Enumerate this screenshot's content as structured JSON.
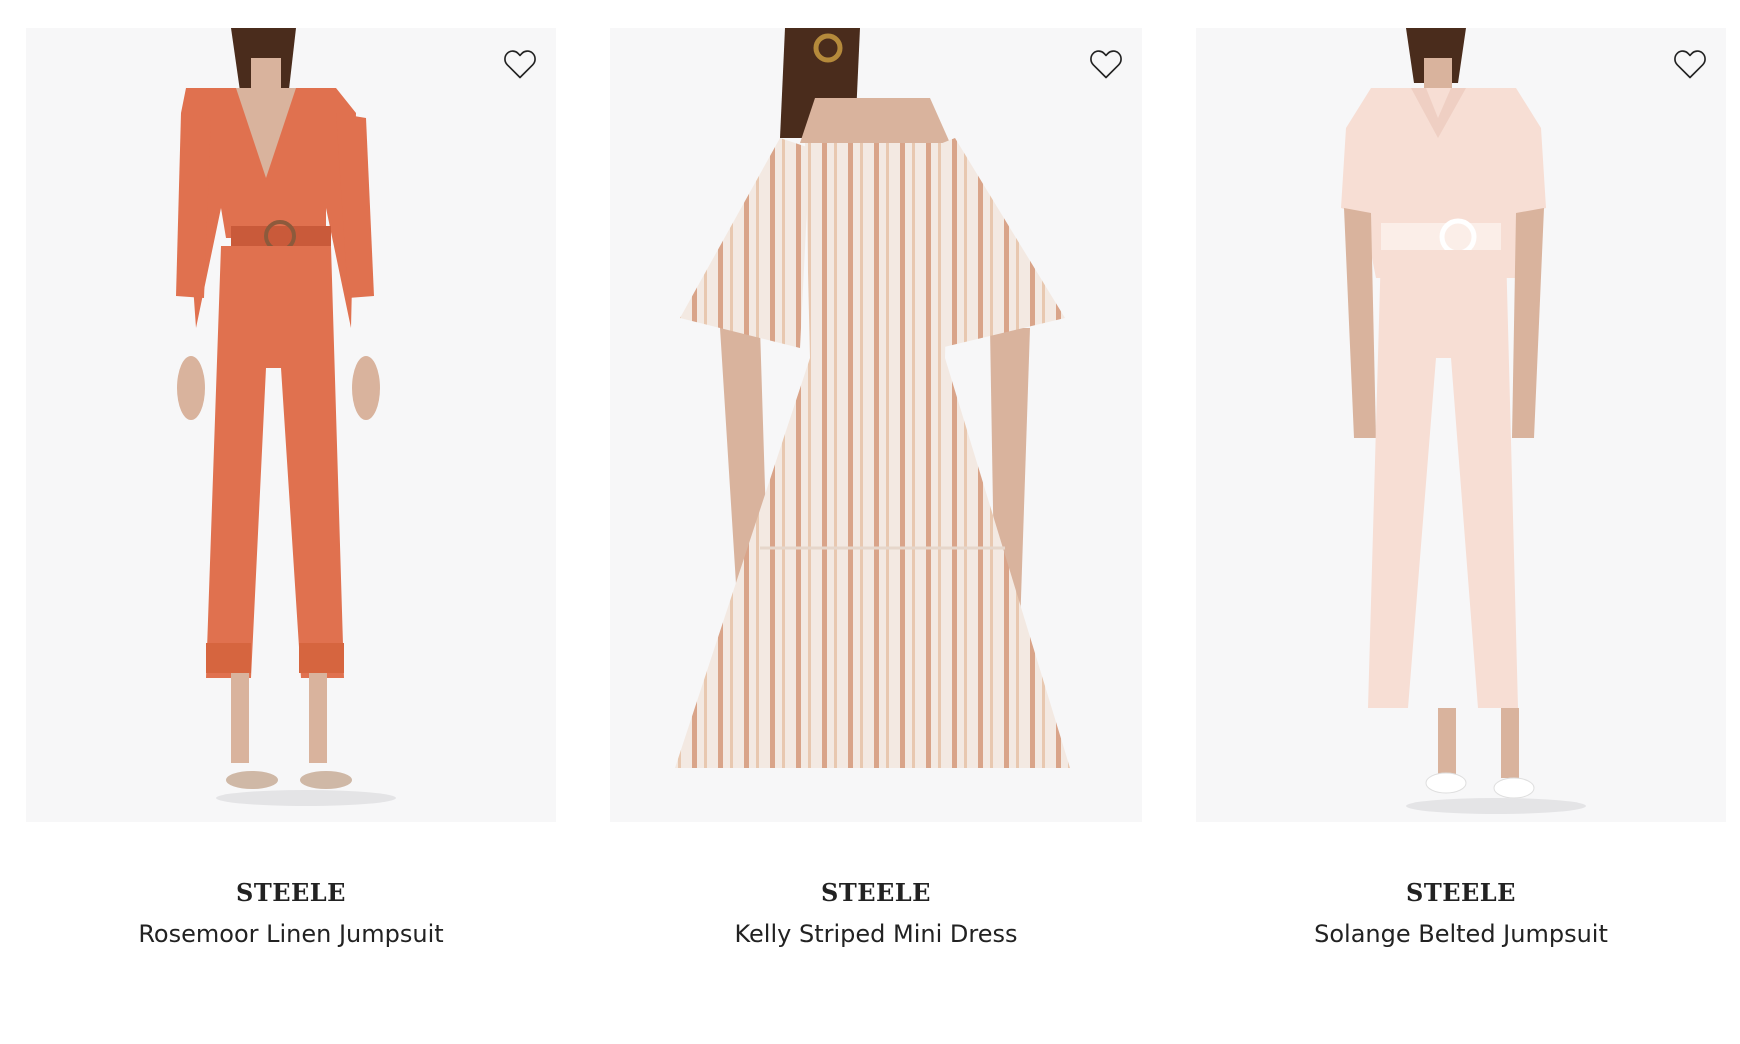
{
  "products": [
    {
      "brand": "STEELE",
      "name": "Rosemoor Linen Jumpsuit",
      "garment_color": "#e0714f",
      "wishlist_icon": "heart-outline-icon"
    },
    {
      "brand": "STEELE",
      "name": "Kelly Striped Mini Dress",
      "garment_color": "#f3e9e2",
      "stripe_color": "#d9a489",
      "wishlist_icon": "heart-outline-icon"
    },
    {
      "brand": "STEELE",
      "name": "Solange Belted Jumpsuit",
      "garment_color": "#f7ded4",
      "wishlist_icon": "heart-outline-icon"
    }
  ],
  "colors": {
    "image_background": "#f7f7f8",
    "text": "#222222",
    "skin": "#d9b39d",
    "hair": "#4a2c1c"
  }
}
